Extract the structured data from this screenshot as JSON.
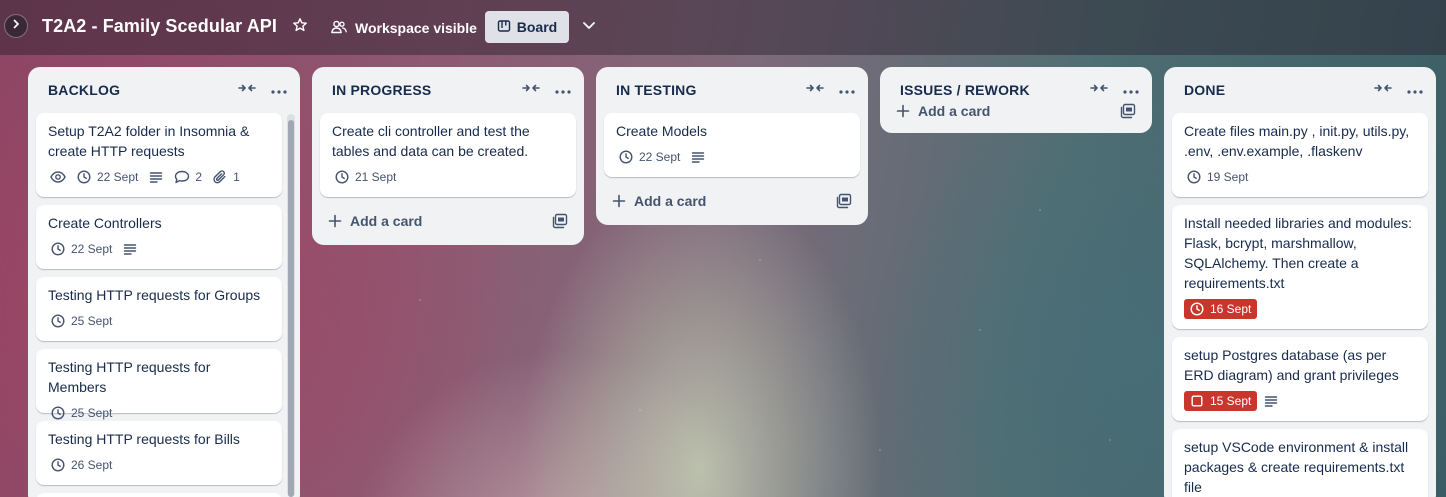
{
  "header": {
    "board_title": "T2A2 - Family Scedular API",
    "visibility_label": "Workspace visible",
    "view_label": "Board"
  },
  "lists": [
    {
      "title": "BACKLOG",
      "cards": [
        {
          "title": "Setup T2A2 folder in Insomnia & create HTTP requests",
          "date": "22 Sept",
          "comments": "2",
          "attachments": "1"
        },
        {
          "title": "Create Controllers",
          "date": "22 Sept"
        },
        {
          "title": "Testing HTTP requests for Groups",
          "date": "25 Sept"
        },
        {
          "title": "Testing HTTP requests for Members",
          "date": "25 Sept"
        },
        {
          "title": "Testing HTTP requests for Bills",
          "date": "26 Sept"
        }
      ]
    },
    {
      "title": "IN PROGRESS",
      "cards": [
        {
          "title": "Create cli controller and test the tables and data can be created.",
          "date": "21 Sept"
        }
      ],
      "add_card_label": "Add a card"
    },
    {
      "title": "IN TESTING",
      "cards": [
        {
          "title": "Create Models",
          "date": "22 Sept"
        }
      ],
      "add_card_label": "Add a card"
    },
    {
      "title": "ISSUES / REWORK",
      "cards": [],
      "add_card_label": "Add a card"
    },
    {
      "title": "DONE",
      "cards": [
        {
          "title": "Create files main.py , init.py, utils.py, .env, .env.example, .flaskenv",
          "date": "19 Sept"
        },
        {
          "title": "Install needed libraries and modules: Flask, bcrypt, marshmallow, SQLAlchemy. Then create a requirements.txt",
          "date": "16 Sept"
        },
        {
          "title": "setup Postgres database (as per ERD diagram) and grant privileges",
          "date": "15 Sept"
        },
        {
          "title": "setup VSCode environment & install packages & create requirements.txt file"
        }
      ]
    }
  ],
  "colors": {
    "list_bg": "#f1f2f4",
    "overdue_badge": "#c9372c",
    "text_primary": "#172b4d",
    "text_secondary": "#44546f"
  }
}
